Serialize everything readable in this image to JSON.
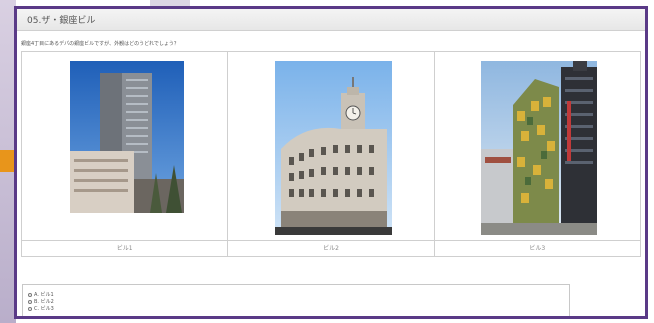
{
  "title": "05.ザ・銀座ビル",
  "question": "銀座4丁目にあるデパの銀座ビルですが、外観はどのうどれでしょう？",
  "buildings": [
    {
      "caption": "ビル1"
    },
    {
      "caption": "ビル2"
    },
    {
      "caption": "ビル3"
    }
  ],
  "options": [
    {
      "label": "A. ビル1"
    },
    {
      "label": "B. ビル2"
    },
    {
      "label": "C. ビル3"
    }
  ],
  "colors": {
    "window_border": "#5a3a87",
    "accent_orange": "#e8951b",
    "sky": "#3a78c9"
  }
}
